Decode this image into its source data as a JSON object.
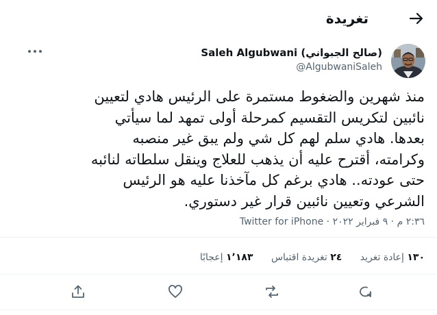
{
  "header": {
    "title": "تغريدة"
  },
  "author": {
    "name": "Saleh Algubwani (صالح الجبواني)",
    "handle": "@AlgubwaniSaleh"
  },
  "tweet": {
    "text": "منذ شهرين والضغوط مستمرة على الرئيس هادي لتعيين\nنائبين لتكريس التقسيم كمرحلة أولى تمهد لما سيأتي\nبعدها. هادي سلم لهم كل شي ولم يبق غير منصبه\nوكرامته، أقترح عليه أن يذهب للعلاج وينقل سلطاته لنائبه\nحتى عودته.. هادي برغم كل مآخذنا عليه هو الرئيس\nالشرعي وتعيين نائبين قرار غير دستوري."
  },
  "meta": {
    "time": "٢:٣٦ م",
    "date": "٩ فبراير ٢٠٢٢",
    "source": "Twitter for iPhone",
    "separator": "·"
  },
  "stats": {
    "retweets": {
      "count": "١٣٠",
      "label": "إعادة تغريد"
    },
    "quotes": {
      "count": "٢٤",
      "label": "تغريدة اقتباس"
    },
    "likes": {
      "count": "١٬١٨٣",
      "label": "إعجابًا"
    }
  },
  "icons": {
    "back": "arrow-right-icon",
    "more": "more-icon",
    "reply": "reply-icon",
    "retweet": "retweet-icon",
    "like": "heart-icon",
    "share": "share-icon"
  },
  "colors": {
    "text": "#0f1419",
    "secondary": "#536471",
    "divider": "#eff3f4"
  }
}
